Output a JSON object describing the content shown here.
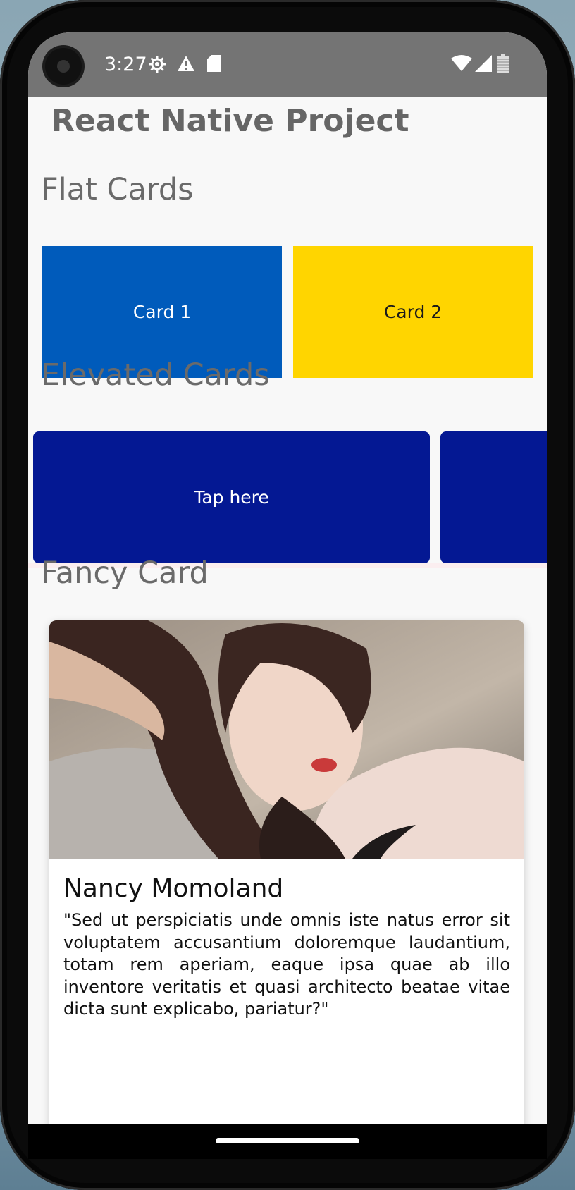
{
  "status_bar": {
    "time": "3:27",
    "icons": [
      "settings-icon",
      "warning-icon",
      "sd-card-icon",
      "wifi-icon",
      "signal-icon",
      "battery-icon"
    ]
  },
  "app": {
    "title": "React Native Project"
  },
  "flat_cards": {
    "heading": "Flat Cards",
    "cards": [
      {
        "label": "Card 1",
        "color": "#005bbb",
        "text_color": "#ffffff"
      },
      {
        "label": "Card 2",
        "color": "#ffd500",
        "text_color": "#1b1b1b"
      }
    ]
  },
  "elevated_cards": {
    "heading": "Elevated Cards",
    "cards": [
      {
        "label": "Tap here",
        "color": "#041893"
      }
    ]
  },
  "fancy_card": {
    "heading": "Fancy Card",
    "name": "Nancy Momoland",
    "description": "\"Sed ut perspiciatis unde omnis iste natus error sit voluptatem accusantium doloremque laudantium, totam rem aperiam, eaque ipsa quae ab illo inventore veritatis et quasi architecto beatae vitae dicta sunt explicabo, pariatur?\""
  }
}
